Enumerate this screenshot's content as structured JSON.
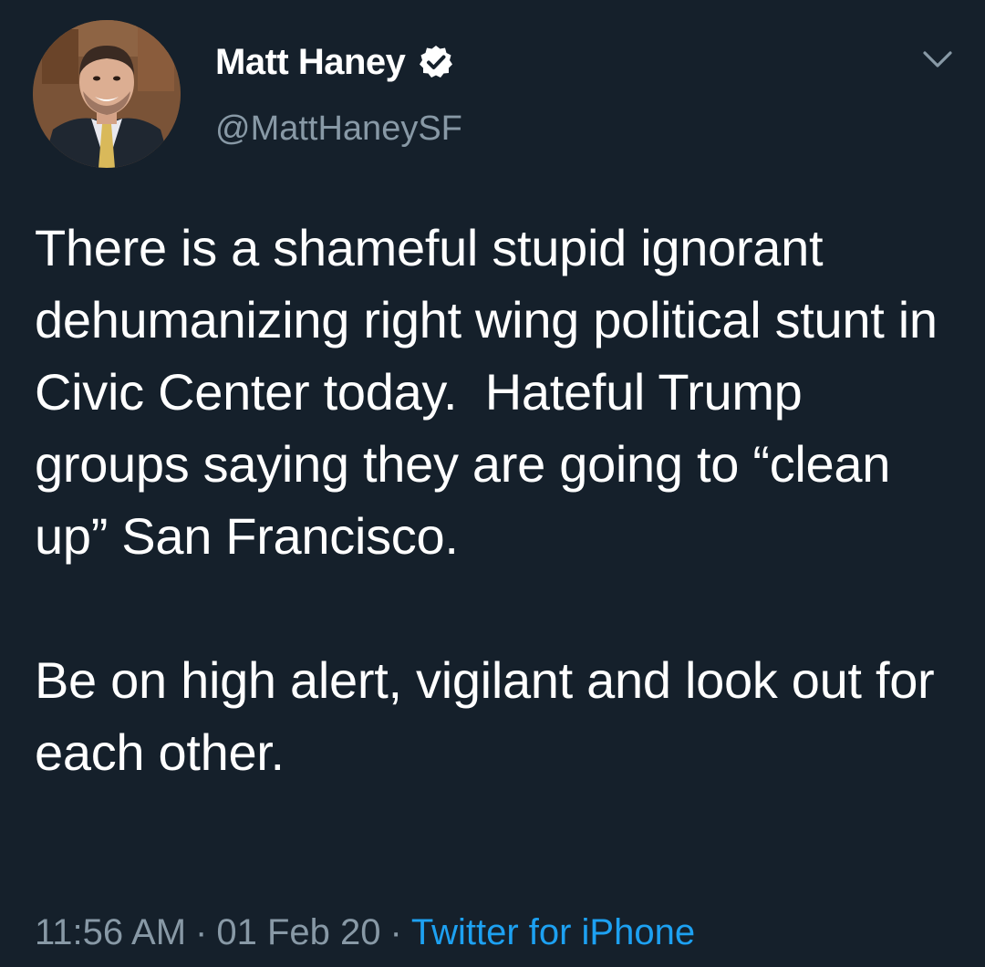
{
  "author": {
    "name": "Matt Haney",
    "handle": "@MattHaneySF",
    "verified_icon": "verified-badge-icon"
  },
  "menu_icon": "chevron-down-icon",
  "tweet": {
    "paragraph_1": "There is a shameful stupid ignorant dehumanizing right wing political stunt in Civic Center today.  Hateful Trump groups saying they are going to “clean up” San Francisco.",
    "paragraph_2": "Be on high alert, vigilant and look out for each other."
  },
  "meta": {
    "time": "11:56 AM",
    "separator": "·",
    "date": "01 Feb 20",
    "source": "Twitter for iPhone"
  },
  "colors": {
    "background": "#15202b",
    "text": "#ffffff",
    "secondary_text": "#8899a6",
    "link": "#1da1f2"
  }
}
